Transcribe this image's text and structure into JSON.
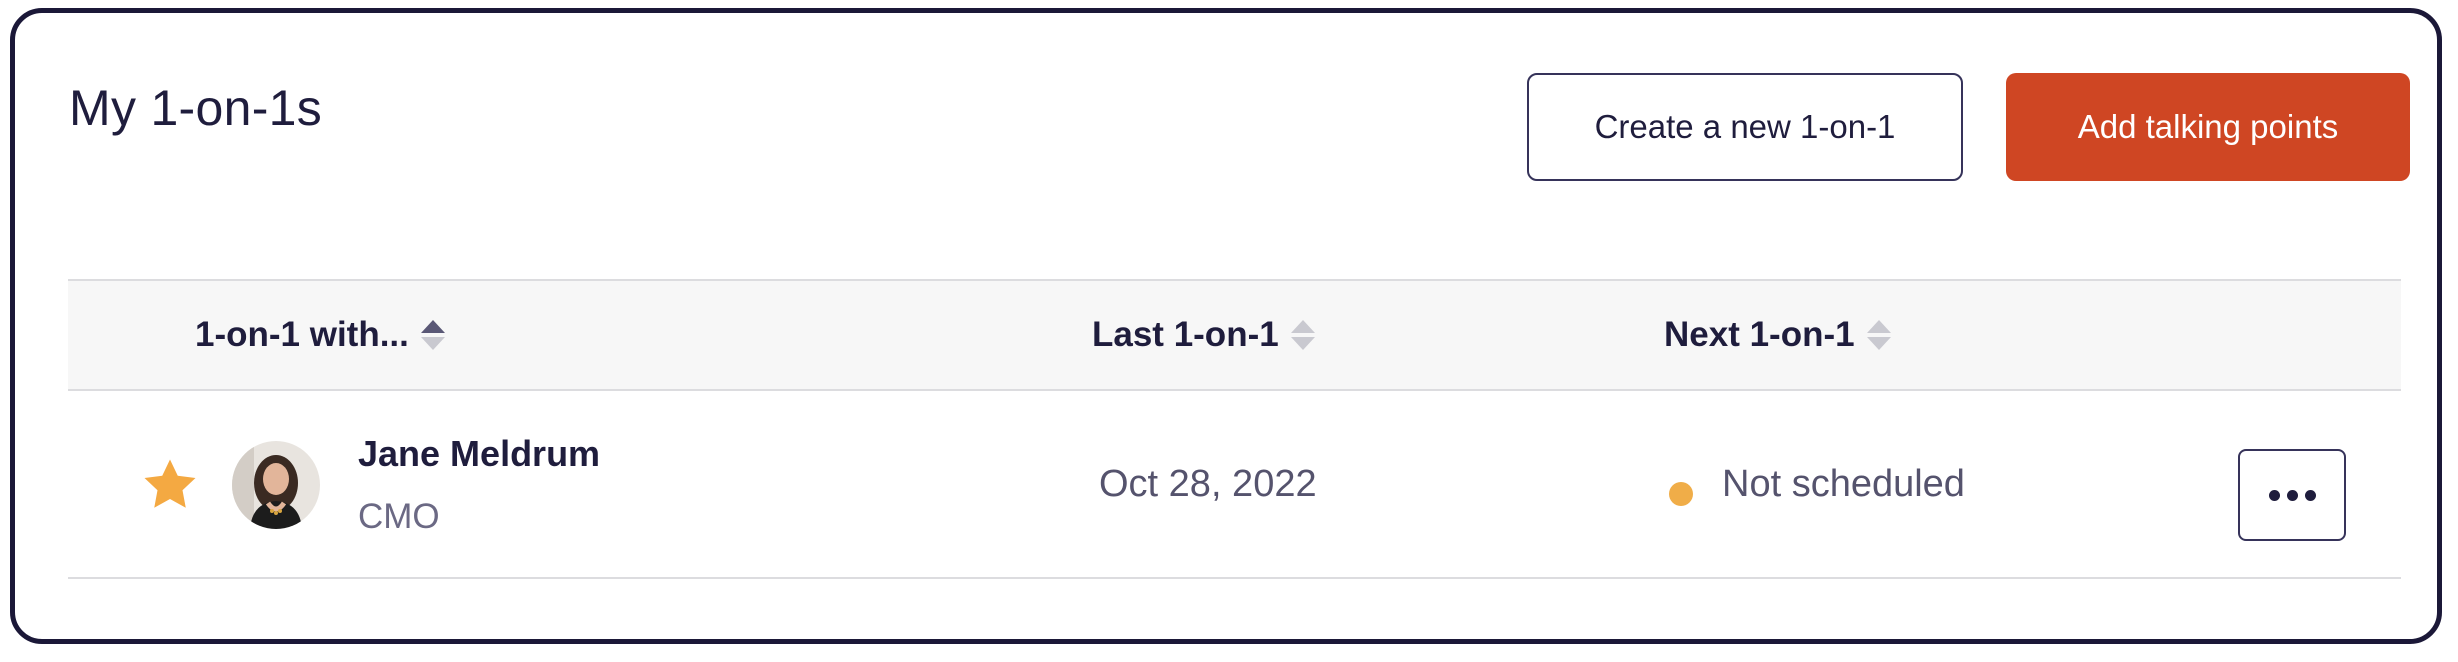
{
  "header": {
    "title": "My 1-on-1s",
    "create_button_label": "Create a new 1-on-1",
    "add_talking_points_label": "Add talking points"
  },
  "table": {
    "columns": [
      {
        "label": "1-on-1 with...",
        "sort": "active-ascending"
      },
      {
        "label": "Last 1-on-1",
        "sort": "none"
      },
      {
        "label": "Next 1-on-1",
        "sort": "none"
      }
    ],
    "rows": [
      {
        "favorite": true,
        "name": "Jane Meldrum",
        "role": "CMO",
        "last_one_on_one": "Oct 28, 2022",
        "next_one_on_one": "Not scheduled",
        "status_color": "#f0ad48"
      }
    ]
  },
  "colors": {
    "primary": "#cf4623",
    "text": "#1f1d3d",
    "star": "#f4a942",
    "frame_border": "#1b1838"
  },
  "icons": {
    "star": "star-icon",
    "sort": "sort-icon",
    "more": "more-horizontal-icon"
  }
}
